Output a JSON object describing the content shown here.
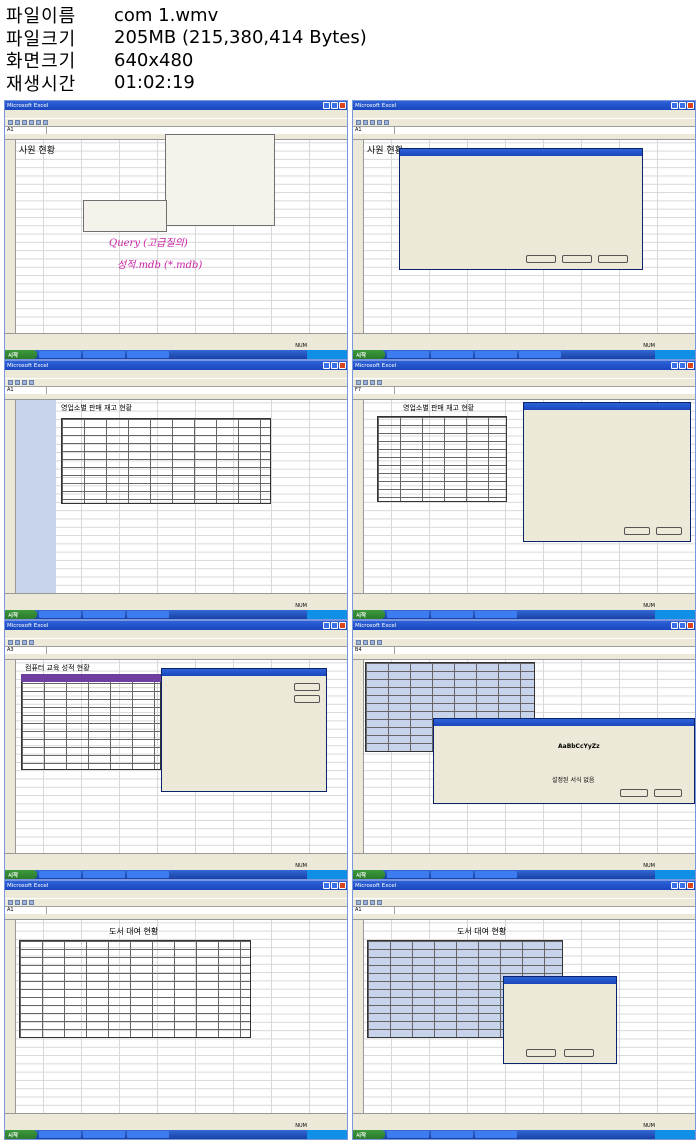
{
  "info": {
    "rows": [
      {
        "key": "파일이름",
        "value": "com 1.wmv"
      },
      {
        "key": "파일크기",
        "value": "205MB (215,380,414 Bytes)"
      },
      {
        "key": "화면크기",
        "value": "640x480"
      },
      {
        "key": "재생시간",
        "value": "01:02:19"
      }
    ]
  },
  "shots": [
    {
      "title": "Microsoft Excel",
      "cell_ref": "A1",
      "sheet_title": "사원 현황",
      "annotations": [
        "Query (고급질의)",
        "성적.mdb (*.mdb)"
      ]
    },
    {
      "title": "Microsoft Excel",
      "cell_ref": "A1",
      "sheet_title": "사원 현황"
    },
    {
      "title": "Microsoft Excel",
      "cell_ref": "A1",
      "sheet_title": "영업소별 판매 재고 현황"
    },
    {
      "title": "Microsoft Excel",
      "cell_ref": "F7",
      "sheet_title": "영업소별 판매 재고 현황"
    },
    {
      "title": "Microsoft Excel",
      "cell_ref": "A3",
      "sheet_title": "컴퓨터 교육 성적 현황"
    },
    {
      "title": "Microsoft Excel",
      "cell_ref": "B4",
      "sheet_title": "",
      "dialog_samples": [
        "AaBbCcYyZz",
        "설정된 서식 없음"
      ]
    },
    {
      "title": "Microsoft Excel",
      "cell_ref": "A1",
      "sheet_title": "도서 대여 현황"
    },
    {
      "title": "Microsoft Excel",
      "cell_ref": "A1",
      "sheet_title": "도서 대여 현황"
    }
  ],
  "taskbar": {
    "start_label": "시작"
  },
  "statusbar": {
    "mode": "NUM"
  }
}
